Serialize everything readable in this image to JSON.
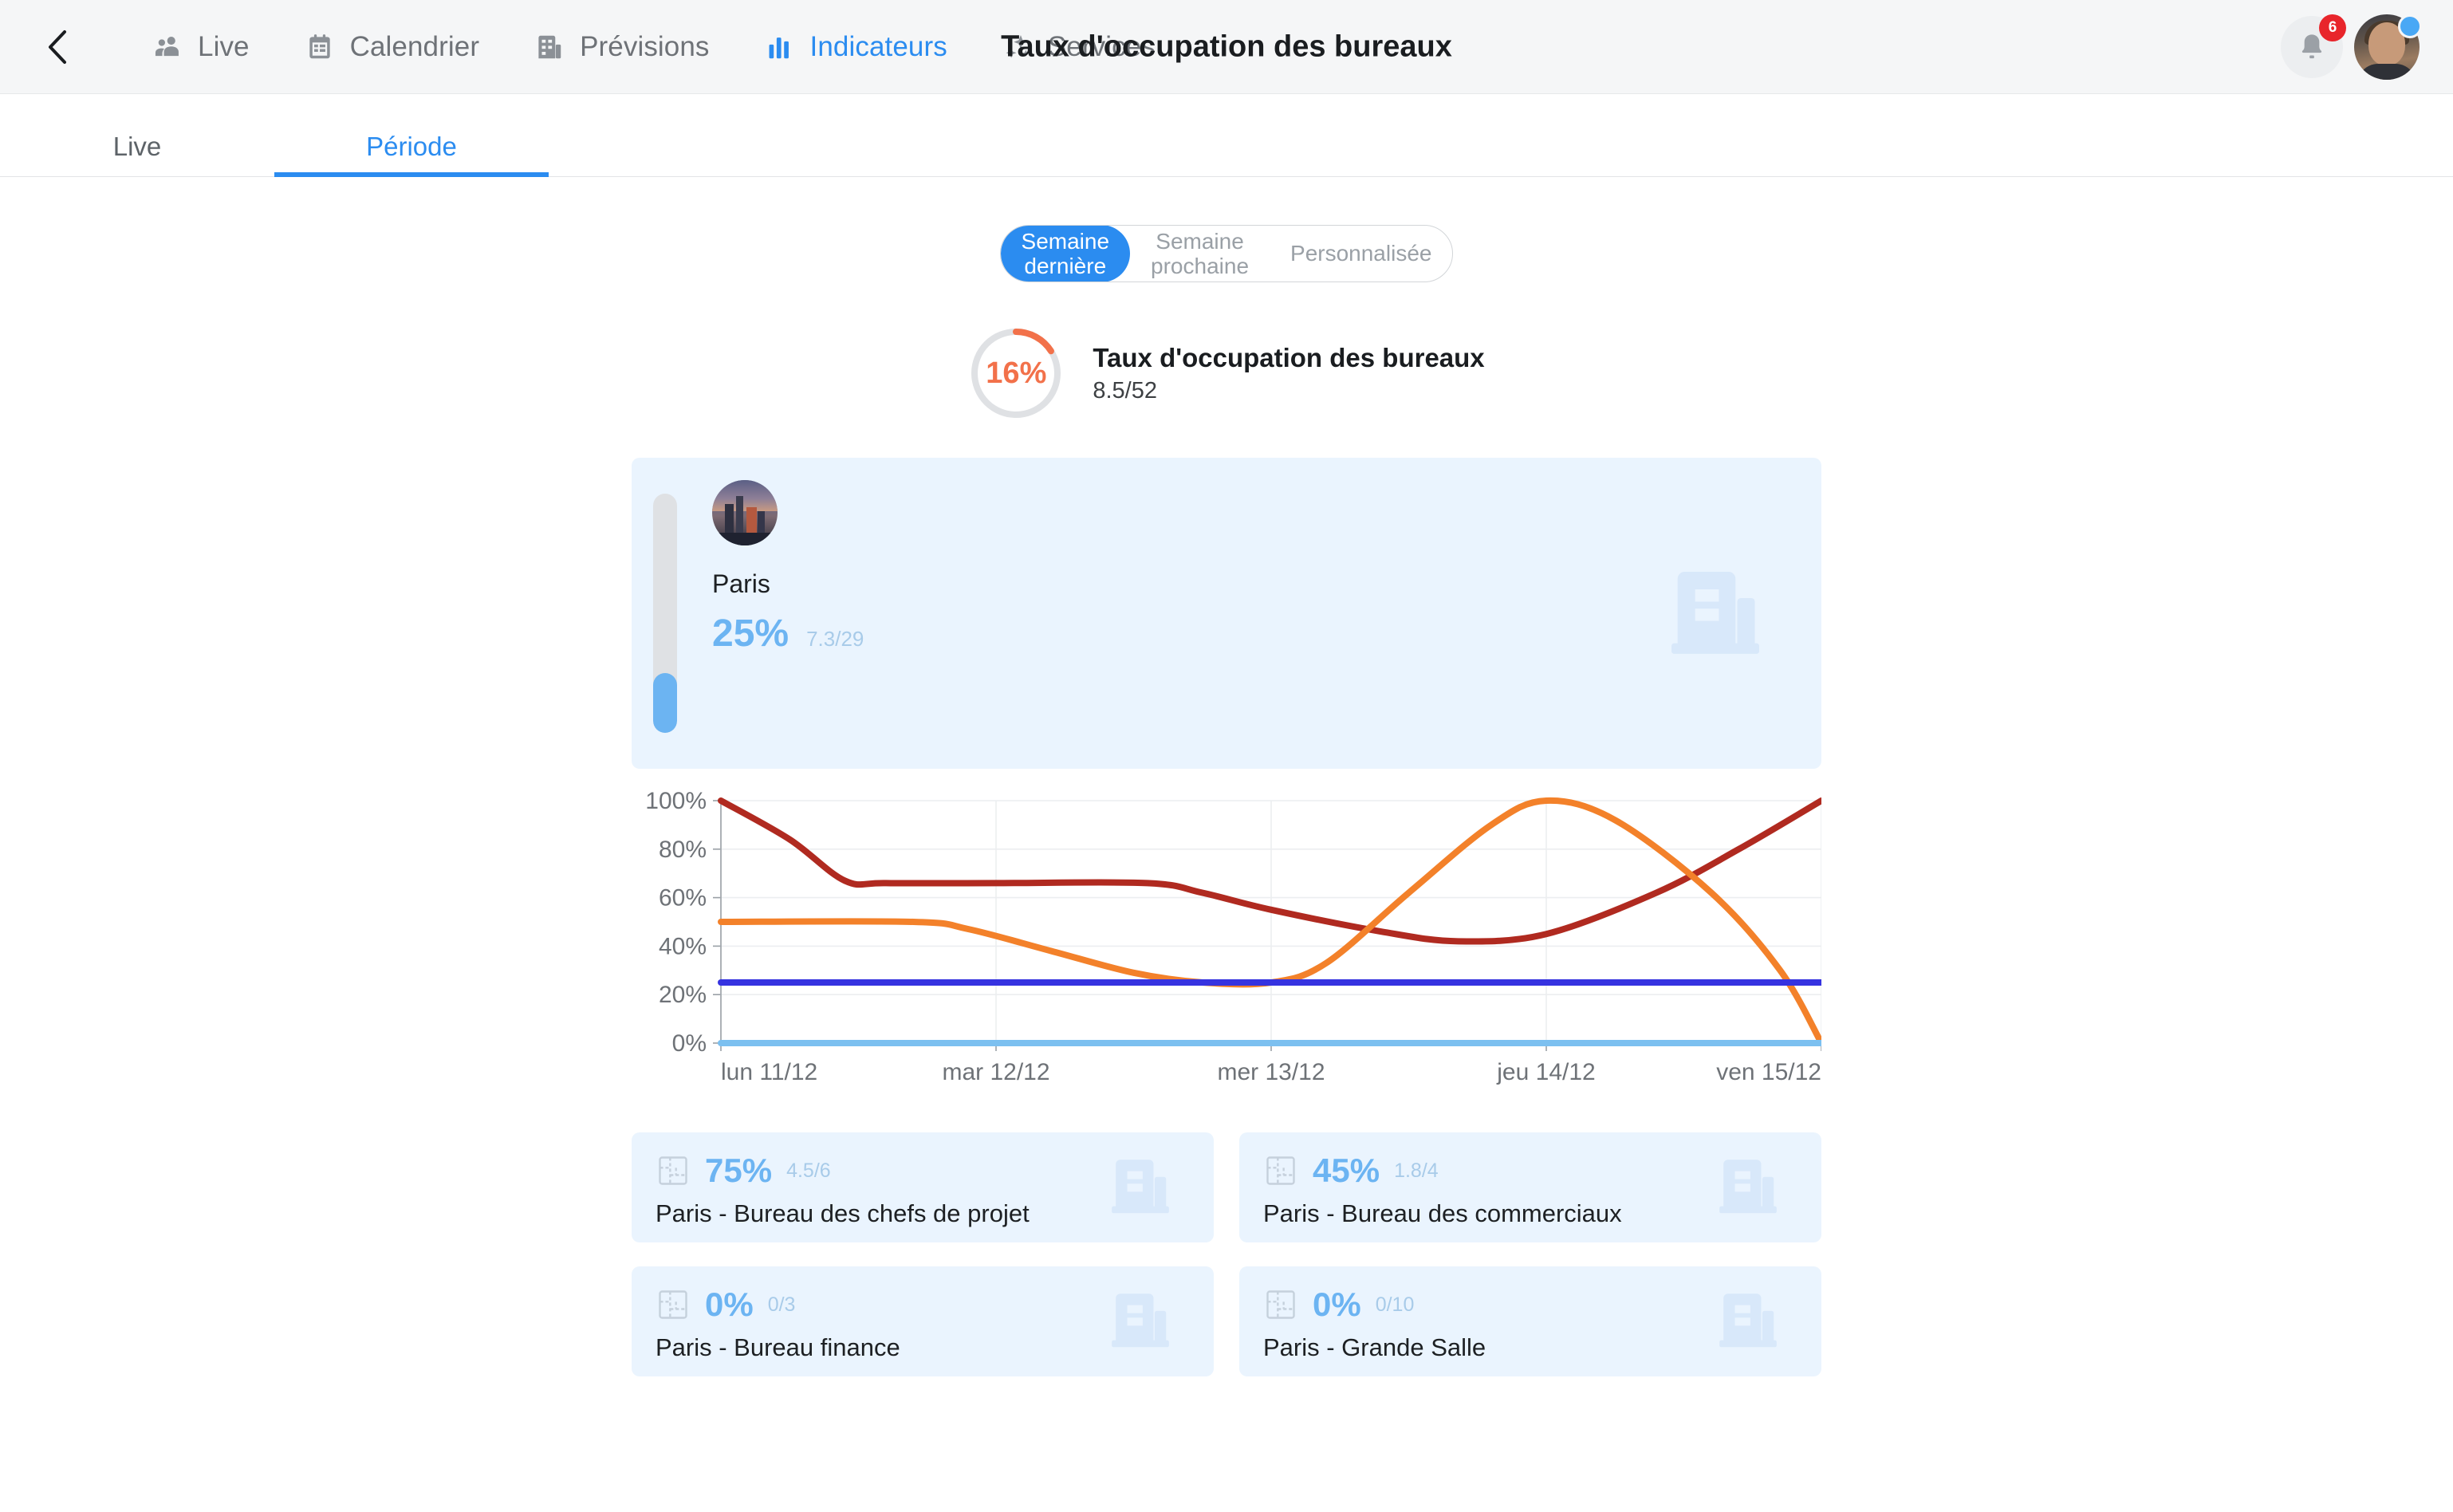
{
  "header": {
    "back_icon": "chevron-left-icon",
    "title": "Taux d'occupation des bureaux",
    "nav": [
      {
        "label": "Live",
        "icon": "people-icon",
        "active": false
      },
      {
        "label": "Calendrier",
        "icon": "calendar-icon",
        "active": false
      },
      {
        "label": "Prévisions",
        "icon": "building-forecast-icon",
        "active": false
      },
      {
        "label": "Indicateurs",
        "icon": "bar-chart-icon",
        "active": true
      },
      {
        "label": "Services",
        "icon": "sparkle-icon",
        "active": false
      }
    ],
    "notifications": {
      "icon": "bell-icon",
      "count": "6"
    },
    "avatar": {
      "name": "avatar",
      "presence": "online"
    }
  },
  "subtabs": [
    {
      "label": "Live",
      "active": false
    },
    {
      "label": "Période",
      "active": true
    }
  ],
  "period_selector": {
    "options": [
      {
        "line1": "Semaine",
        "line2": "dernière",
        "active": true
      },
      {
        "line1": "Semaine",
        "line2": "prochaine",
        "active": false
      },
      {
        "line1": "Personnalisée",
        "line2": "",
        "active": false
      }
    ]
  },
  "summary": {
    "percent": "16%",
    "percent_value": 16,
    "title": "Taux d'occupation des bureaux",
    "ratio": "8.5/52",
    "accent_color": "#f2714a",
    "track_color": "#dfe1e4"
  },
  "site": {
    "name": "Paris",
    "percent": "25%",
    "percent_value": 25,
    "ratio": "7.3/29",
    "thumb_icon": "city-photo",
    "watermark_icon": "building-icon",
    "bar_color": "#6cb4f2",
    "card_bg": "#eaf4fe"
  },
  "chart_data": {
    "type": "line",
    "title": "",
    "xlabel": "",
    "ylabel": "",
    "ylim": [
      0,
      100
    ],
    "ytick_labels": [
      "0%",
      "20%",
      "40%",
      "60%",
      "80%",
      "100%"
    ],
    "yticks": [
      0,
      20,
      40,
      60,
      80,
      100
    ],
    "grid": true,
    "legend": "none",
    "categories": [
      "lun 11/12",
      "mar 12/12",
      "mer 13/12",
      "jeu 14/12",
      "ven 15/12"
    ],
    "x": [
      0,
      1,
      2,
      3,
      4
    ],
    "series": [
      {
        "name": "dark-red",
        "color": "#b02a20",
        "values": [
          100,
          66,
          66,
          42,
          100
        ],
        "points": [
          [
            0.0,
            100
          ],
          [
            0.25,
            84
          ],
          [
            0.45,
            67
          ],
          [
            0.6,
            66
          ],
          [
            1.0,
            66
          ],
          [
            1.55,
            66
          ],
          [
            1.75,
            62
          ],
          [
            2.0,
            55
          ],
          [
            2.4,
            46
          ],
          [
            2.68,
            42
          ],
          [
            3.0,
            45
          ],
          [
            3.4,
            62
          ],
          [
            3.7,
            80
          ],
          [
            4.0,
            100
          ]
        ]
      },
      {
        "name": "orange",
        "color": "#f3812a",
        "values": [
          50,
          50,
          25,
          100,
          0
        ],
        "points": [
          [
            0.0,
            50
          ],
          [
            0.7,
            50
          ],
          [
            0.9,
            47
          ],
          [
            1.2,
            38
          ],
          [
            1.5,
            29
          ],
          [
            1.75,
            25
          ],
          [
            2.0,
            25
          ],
          [
            2.2,
            33
          ],
          [
            2.5,
            62
          ],
          [
            2.8,
            90
          ],
          [
            3.0,
            100
          ],
          [
            3.25,
            92
          ],
          [
            3.6,
            62
          ],
          [
            3.85,
            30
          ],
          [
            4.0,
            0
          ]
        ]
      },
      {
        "name": "blue",
        "color": "#3633e0",
        "values": [
          25,
          25,
          25,
          25,
          25
        ],
        "points": [
          [
            0,
            25
          ],
          [
            4,
            25
          ]
        ]
      },
      {
        "name": "light-blue",
        "color": "#7cc0f0",
        "values": [
          0,
          0,
          0,
          0,
          0
        ],
        "points": [
          [
            0,
            0
          ],
          [
            4,
            0
          ]
        ]
      }
    ]
  },
  "rooms": [
    {
      "percent": "75%",
      "ratio": "4.5/6",
      "name": "Paris - Bureau des chefs de projet",
      "icon": "floorplan-icon",
      "watermark_icon": "building-icon"
    },
    {
      "percent": "45%",
      "ratio": "1.8/4",
      "name": "Paris - Bureau des commerciaux",
      "icon": "floorplan-icon",
      "watermark_icon": "building-icon"
    },
    {
      "percent": "0%",
      "ratio": "0/3",
      "name": "Paris - Bureau finance",
      "icon": "floorplan-icon",
      "watermark_icon": "building-icon"
    },
    {
      "percent": "0%",
      "ratio": "0/10",
      "name": "Paris - Grande Salle",
      "icon": "floorplan-icon",
      "watermark_icon": "building-icon"
    }
  ],
  "colors": {
    "accent_blue": "#2b8cf0",
    "card_bg": "#eaf4fe",
    "value_blue": "#6cb4f2",
    "orange": "#f2714a",
    "topbar_bg": "#f5f6f7"
  }
}
